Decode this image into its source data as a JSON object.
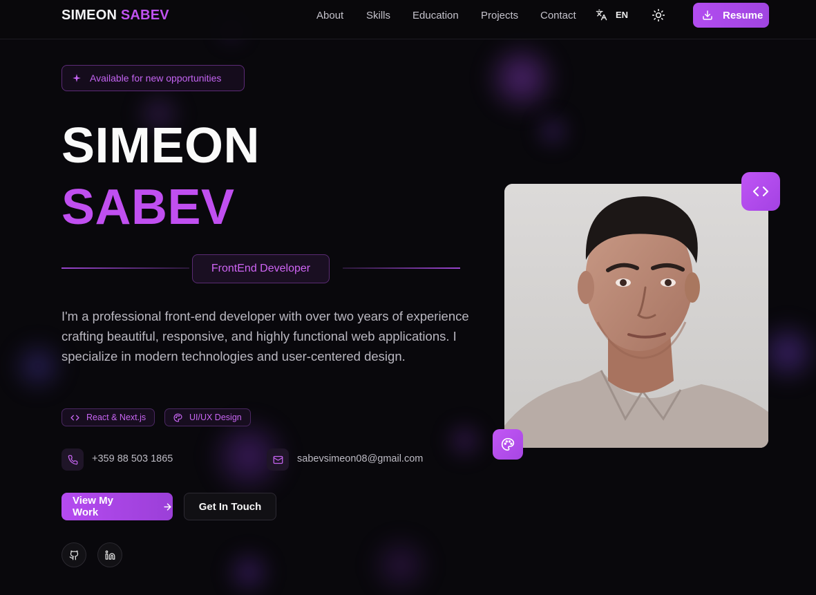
{
  "header": {
    "logo_first": "SIMEON",
    "logo_last": "SABEV",
    "nav": [
      "About",
      "Skills",
      "Education",
      "Projects",
      "Contact"
    ],
    "language": "EN",
    "resume_label": "Resume"
  },
  "hero": {
    "availability": "Available for new opportunities",
    "first_name": "SIMEON",
    "last_name": "SABEV",
    "role": "FrontEnd Developer",
    "description": "I'm a professional front-end developer with over two years of experience crafting beautiful, responsive, and highly functional web applications. I specialize in modern technologies and user-centered design.",
    "tags": [
      "React & Next.js",
      "UI/UX Design"
    ],
    "phone": "+359 88 503 1865",
    "email": "sabevsimeon08@gmail.com",
    "primary_cta": "View My Work",
    "secondary_cta": "Get In Touch"
  },
  "icons": {
    "language": "translate-icon",
    "theme": "sun-icon",
    "resume": "download-icon",
    "availability": "sparkle-icon",
    "tag_react": "code-icon",
    "tag_design": "palette-icon",
    "phone": "phone-icon",
    "email": "mail-icon",
    "cta": "arrow-right-icon",
    "social": [
      "github-icon",
      "linkedin-icon"
    ],
    "photo_badges": [
      "code-icon",
      "palette-icon"
    ]
  },
  "colors": {
    "background": "#09080c",
    "accent": "#c04ff0",
    "text": "#fafafa"
  }
}
